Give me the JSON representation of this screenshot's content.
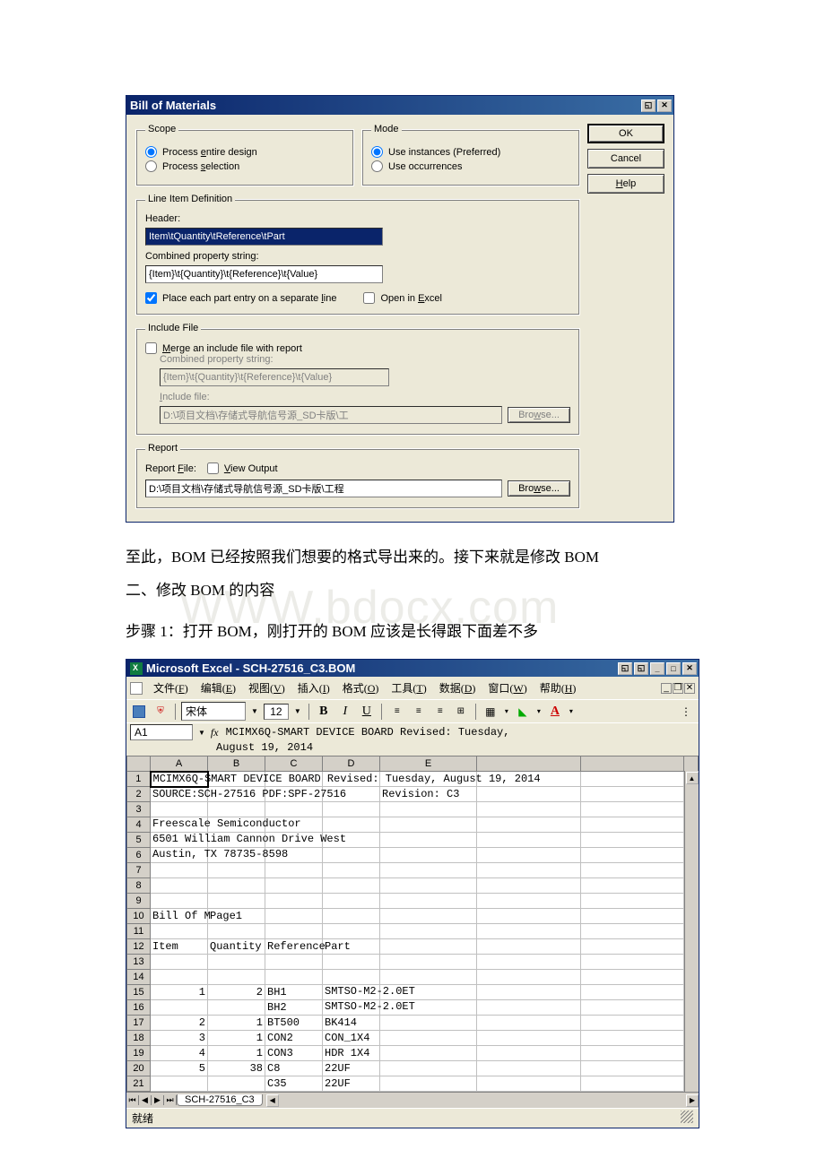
{
  "dialog": {
    "title": "Bill of Materials",
    "buttons": {
      "ok": "OK",
      "cancel": "Cancel",
      "help": "Help"
    },
    "scope": {
      "legend": "Scope",
      "entire": "Process entire design",
      "entire_key": "e",
      "selection": "Process selection",
      "selection_key": "s"
    },
    "mode": {
      "legend": "Mode",
      "instances": "Use instances (Preferred)",
      "occurrences": "Use occurrences"
    },
    "lineitem": {
      "legend": "Line Item Definition",
      "header_label": "Header:",
      "header_value": "Item\\tQuantity\\tReference\\tPart",
      "combined_label": "Combined property string:",
      "combined_value": "{Item}\\t{Quantity}\\t{Reference}\\t{Value}",
      "place_each": "Place each part entry on a separate line",
      "place_key": "l",
      "open_excel": "Open in Excel",
      "open_key": "E"
    },
    "include": {
      "legend": "Include File",
      "merge": "Merge an include file with report",
      "merge_key": "M",
      "combined_label": "Combined property string:",
      "combined_value": "{Item}\\t{Quantity}\\t{Reference}\\t{Value}",
      "include_label": "Include file:",
      "include_key": "I",
      "include_value": "D:\\项目文档\\存储式导航信号源_SD卡版\\工",
      "browse": "Browse...",
      "browse_key": "w"
    },
    "report": {
      "legend": "Report",
      "file_label": "Report File:",
      "file_key": "F",
      "view_output": "View Output",
      "view_key": "V",
      "file_value": "D:\\项目文档\\存储式导航信号源_SD卡版\\工程",
      "browse": "Browse...",
      "browse_key": "w"
    }
  },
  "midtext": {
    "line1": "至此，BOM 已经按照我们想要的格式导出来的。接下来就是修改 BOM",
    "line2": "二、修改 BOM 的内容",
    "line3": "步骤 1：打开 BOM，刚打开的 BOM 应该是长得跟下面差不多",
    "watermark": "WWW.bdocx.com"
  },
  "excel": {
    "title": "Microsoft Excel - SCH-27516_C3.BOM",
    "menus": {
      "file": "文件(F)",
      "edit": "编辑(E)",
      "view": "视图(V)",
      "insert": "插入(I)",
      "format": "格式(O)",
      "tools": "工具(T)",
      "data": "数据(D)",
      "window": "窗口(W)",
      "help": "帮助(H)"
    },
    "font": "宋体",
    "size": "12",
    "cell_ref": "A1",
    "formula": "MCIMX6Q-SMART DEVICE BOARD  Revised: Tuesday,",
    "formula2": "August 19, 2014",
    "col_headers": {
      "a": "A",
      "b": "B",
      "c": "C",
      "d": "D",
      "e": "E"
    },
    "rows": [
      {
        "n": "1",
        "a": "MCIMX6Q-SMART DEVICE BOARD  Revised: Tuesday, August 19, 2014"
      },
      {
        "n": "2",
        "a": "SOURCE:SCH-27516 PDF:SPF-27516",
        "e": "Revision: C3"
      },
      {
        "n": "3"
      },
      {
        "n": "4",
        "a": "Freescale Semiconductor"
      },
      {
        "n": "5",
        "a": "6501 William Cannon Drive West"
      },
      {
        "n": "6",
        "a": "Austin, TX 78735-8598"
      },
      {
        "n": "7"
      },
      {
        "n": "8"
      },
      {
        "n": "9"
      },
      {
        "n": "10",
        "a": "Bill Of M",
        "b": "Page1"
      },
      {
        "n": "11"
      },
      {
        "n": "12",
        "a": "Item",
        "b": "Quantity",
        "c": "Reference",
        "d": "Part"
      },
      {
        "n": "13"
      },
      {
        "n": "14"
      },
      {
        "n": "15",
        "a": "1",
        "b": "2",
        "c": "BH1",
        "d": "SMTSO-M2-2.0ET"
      },
      {
        "n": "16",
        "c": "BH2",
        "d": "SMTSO-M2-2.0ET"
      },
      {
        "n": "17",
        "a": "2",
        "b": "1",
        "c": "BT500",
        "d": "BK414"
      },
      {
        "n": "18",
        "a": "3",
        "b": "1",
        "c": "CON2",
        "d": "CON_1X4"
      },
      {
        "n": "19",
        "a": "4",
        "b": "1",
        "c": "CON3",
        "d": "HDR 1X4"
      },
      {
        "n": "20",
        "a": "5",
        "b": "38",
        "c": "C8",
        "d": "22UF"
      },
      {
        "n": "21",
        "c": "C35",
        "d": "22UF"
      }
    ],
    "sheet": "SCH-27516_C3",
    "status": "就绪"
  }
}
